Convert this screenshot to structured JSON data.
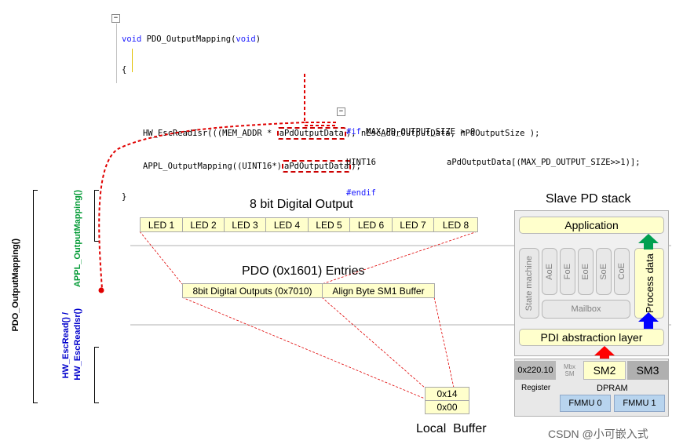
{
  "code": {
    "func_void": "void",
    "func_sig": " PDO_OutputMapping(",
    "func_param": "void",
    "func_close": ")",
    "open_brace": "{",
    "close_brace": "}",
    "l1_pre": "HW_EscReadIsr(((MEM_ADDR * ",
    "l1_hl": "aPdOutputData",
    "l1_post": "), nEscAddrOutputData, nPdOutputSize );",
    "l2_pre": "APPL_OutputMapping((UINT16*)",
    "l2_hl": "aPdOutputData",
    "l2_post": ");",
    "if_kw": "#if",
    "if_cond": " MAX_PD_OUTPUT_SIZE > 0",
    "decl_type": "UINT16",
    "decl_var": "aPdOutputData[(MAX_PD_OUTPUT_SIZE>>1)];",
    "endif_kw": "#endif",
    "fold_minus": "−"
  },
  "labels": {
    "pdo_output_mapping": "PDO_OutputMapping()",
    "appl_output_mapping": "APPL_OutputMapping()",
    "hw_esc_read": "HW_EscRead() /",
    "hw_esc_read_isr": "HW_EscReadIsr()"
  },
  "digital_output": {
    "title": "8 bit Digital Output",
    "leds": [
      "LED 1",
      "LED 2",
      "LED 3",
      "LED 4",
      "LED 5",
      "LED 6",
      "LED 7",
      "LED 8"
    ]
  },
  "pdo_entries": {
    "title": "PDO (0x1601) Entries",
    "entries": [
      "8bit Digital Outputs (0x7010)",
      "Align Byte SM1 Buffer"
    ]
  },
  "local_buffer": {
    "title": "Local  Buffer",
    "cells": [
      "0x14",
      "0x00"
    ]
  },
  "stack": {
    "title": "Slave PD stack",
    "application": "Application",
    "state_machine": "State machine",
    "protocols": [
      "AoE",
      "FoE",
      "EoE",
      "SoE",
      "CoE"
    ],
    "mailbox": "Mailbox",
    "process_data": "Process data",
    "pdi": "PDI abstraction layer",
    "register_addr": "0x220.10",
    "register": "Register",
    "mbx_sm": "Mbx SM",
    "sm2": "SM2",
    "sm3": "SM3",
    "dpram": "DPRAM",
    "fmmu0": "FMMU 0",
    "fmmu1": "FMMU 1"
  },
  "watermark": "CSDN @小可嵌入式",
  "colors": {
    "keyword": "#1a1aff",
    "highlight_border": "#cc0000",
    "label_green": "#009933",
    "label_blue": "#0000cc",
    "cell_fill": "#ffffcc",
    "arrow_red": "#ff0000",
    "arrow_green": "#00a050",
    "arrow_blue": "#0000ff"
  }
}
